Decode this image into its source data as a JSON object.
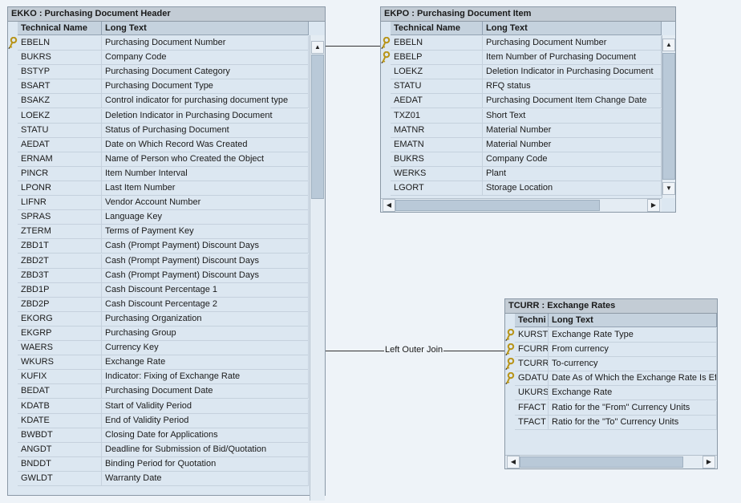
{
  "tables": [
    {
      "id": "ekko",
      "title": "EKKO : Purchasing Document Header",
      "columns": {
        "tech": "Technical Name",
        "long": "Long Text"
      },
      "rows": [
        {
          "tech": "EBELN",
          "long": "Purchasing Document Number",
          "key": true
        },
        {
          "tech": "BUKRS",
          "long": "Company Code"
        },
        {
          "tech": "BSTYP",
          "long": "Purchasing Document Category"
        },
        {
          "tech": "BSART",
          "long": "Purchasing Document Type"
        },
        {
          "tech": "BSAKZ",
          "long": "Control indicator for purchasing document type"
        },
        {
          "tech": "LOEKZ",
          "long": "Deletion Indicator in Purchasing Document"
        },
        {
          "tech": "STATU",
          "long": "Status of Purchasing Document"
        },
        {
          "tech": "AEDAT",
          "long": "Date on Which Record Was Created"
        },
        {
          "tech": "ERNAM",
          "long": "Name of Person who Created the Object"
        },
        {
          "tech": "PINCR",
          "long": "Item Number Interval"
        },
        {
          "tech": "LPONR",
          "long": "Last Item Number"
        },
        {
          "tech": "LIFNR",
          "long": "Vendor Account Number"
        },
        {
          "tech": "SPRAS",
          "long": "Language Key"
        },
        {
          "tech": "ZTERM",
          "long": "Terms of Payment Key"
        },
        {
          "tech": "ZBD1T",
          "long": "Cash (Prompt Payment) Discount Days"
        },
        {
          "tech": "ZBD2T",
          "long": "Cash (Prompt Payment) Discount Days"
        },
        {
          "tech": "ZBD3T",
          "long": "Cash (Prompt Payment) Discount Days"
        },
        {
          "tech": "ZBD1P",
          "long": "Cash Discount Percentage 1"
        },
        {
          "tech": "ZBD2P",
          "long": "Cash Discount Percentage 2"
        },
        {
          "tech": "EKORG",
          "long": "Purchasing Organization"
        },
        {
          "tech": "EKGRP",
          "long": "Purchasing Group"
        },
        {
          "tech": "WAERS",
          "long": "Currency Key"
        },
        {
          "tech": "WKURS",
          "long": "Exchange Rate"
        },
        {
          "tech": "KUFIX",
          "long": "Indicator: Fixing of Exchange Rate"
        },
        {
          "tech": "BEDAT",
          "long": "Purchasing Document Date"
        },
        {
          "tech": "KDATB",
          "long": "Start of Validity Period"
        },
        {
          "tech": "KDATE",
          "long": "End of Validity Period"
        },
        {
          "tech": "BWBDT",
          "long": "Closing Date for Applications"
        },
        {
          "tech": "ANGDT",
          "long": "Deadline for Submission of Bid/Quotation"
        },
        {
          "tech": "BNDDT",
          "long": "Binding Period for Quotation"
        },
        {
          "tech": "GWLDT",
          "long": "Warranty Date"
        }
      ]
    },
    {
      "id": "ekpo",
      "title": "EKPO : Purchasing Document Item",
      "columns": {
        "tech": "Technical Name",
        "long": "Long Text"
      },
      "rows": [
        {
          "tech": "EBELN",
          "long": "Purchasing Document Number",
          "key": true
        },
        {
          "tech": "EBELP",
          "long": "Item Number of Purchasing Document",
          "key": true
        },
        {
          "tech": "LOEKZ",
          "long": "Deletion Indicator in Purchasing Document"
        },
        {
          "tech": "STATU",
          "long": "RFQ status"
        },
        {
          "tech": "AEDAT",
          "long": "Purchasing Document Item Change Date"
        },
        {
          "tech": "TXZ01",
          "long": "Short Text"
        },
        {
          "tech": "MATNR",
          "long": "Material Number"
        },
        {
          "tech": "EMATN",
          "long": "Material Number"
        },
        {
          "tech": "BUKRS",
          "long": "Company Code"
        },
        {
          "tech": "WERKS",
          "long": "Plant"
        },
        {
          "tech": "LGORT",
          "long": "Storage Location"
        }
      ]
    },
    {
      "id": "tcurr",
      "title": "TCURR : Exchange Rates",
      "columns": {
        "tech": "Techni",
        "long": "Long Text"
      },
      "rows": [
        {
          "tech": "KURST",
          "long": "Exchange Rate Type",
          "key": true
        },
        {
          "tech": "FCURR",
          "long": "From currency",
          "key": true
        },
        {
          "tech": "TCURR",
          "long": "To-currency",
          "key": true
        },
        {
          "tech": "GDATU",
          "long": "Date As of Which the Exchange Rate Is Effe",
          "key": true
        },
        {
          "tech": "UKURS",
          "long": "Exchange Rate"
        },
        {
          "tech": "FFACT",
          "long": "Ratio for the \"From\" Currency Units"
        },
        {
          "tech": "TFACT",
          "long": "Ratio for the \"To\" Currency Units"
        }
      ]
    }
  ],
  "join": {
    "label": "Left Outer Join"
  },
  "icons": {
    "key": "key-icon",
    "up": "scroll-up-arrow-icon",
    "down": "scroll-down-arrow-icon",
    "left": "scroll-left-arrow-icon",
    "right": "scroll-right-arrow-icon"
  },
  "colors": {
    "background": "#eef3f8",
    "table_body": "#dce7f1",
    "title_bar": "#c3ccd5",
    "header": "#c5d2de",
    "key_icon": "#b89418"
  }
}
